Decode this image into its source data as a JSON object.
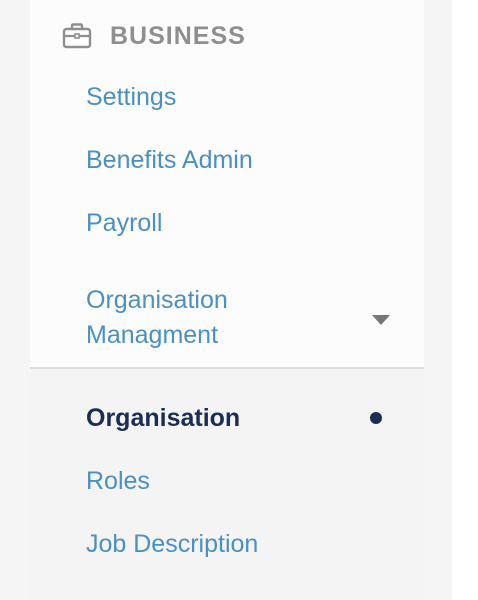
{
  "section": {
    "title": "BUSINESS",
    "icon": "briefcase-icon"
  },
  "nav": {
    "settings": "Settings",
    "benefits_admin": "Benefits Admin",
    "payroll": "Payroll",
    "org_management": "Organisation Managment"
  },
  "subnav": {
    "organisation": "Organisation",
    "roles": "Roles",
    "job_description": "Job Description"
  },
  "colors": {
    "link": "#4a90c4",
    "active": "#1b2d55",
    "header": "#8f8f8f"
  }
}
